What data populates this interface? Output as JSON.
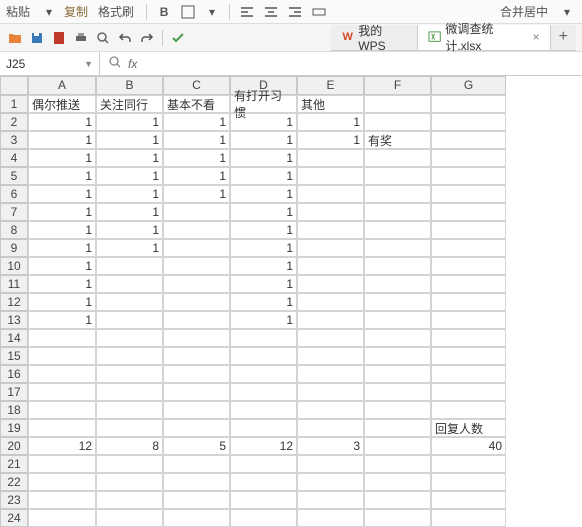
{
  "toolbar": {
    "paste_label": "粘贴",
    "copy_label": "复制",
    "format_painter_label": "格式刷",
    "merge_center_label": "合并居中"
  },
  "tabs": [
    {
      "label": "我的WPS",
      "icon": "wps-logo",
      "active": false
    },
    {
      "label": "微调查统计.xlsx",
      "icon": "excel-icon",
      "active": true
    }
  ],
  "namebox": {
    "value": "J25"
  },
  "formula": {
    "value": ""
  },
  "grid": {
    "columns": [
      "A",
      "B",
      "C",
      "D",
      "E",
      "F",
      "G"
    ],
    "row_count": 24,
    "headers_row": 1,
    "headers": [
      "偶尔推送",
      "关注同行",
      "基本不看",
      "有打开习惯",
      "其他",
      "",
      ""
    ],
    "data": {
      "2": {
        "A": "1",
        "B": "1",
        "C": "1",
        "D": "1",
        "E": "1"
      },
      "3": {
        "A": "1",
        "B": "1",
        "C": "1",
        "D": "1",
        "E": "1",
        "F": "有奖"
      },
      "4": {
        "A": "1",
        "B": "1",
        "C": "1",
        "D": "1"
      },
      "5": {
        "A": "1",
        "B": "1",
        "C": "1",
        "D": "1"
      },
      "6": {
        "A": "1",
        "B": "1",
        "C": "1",
        "D": "1"
      },
      "7": {
        "A": "1",
        "B": "1",
        "D": "1"
      },
      "8": {
        "A": "1",
        "B": "1",
        "D": "1"
      },
      "9": {
        "A": "1",
        "B": "1",
        "D": "1"
      },
      "10": {
        "A": "1",
        "D": "1"
      },
      "11": {
        "A": "1",
        "D": "1"
      },
      "12": {
        "A": "1",
        "D": "1"
      },
      "13": {
        "A": "1",
        "D": "1"
      },
      "19": {
        "G": "回复人数"
      },
      "20": {
        "A": "12",
        "B": "8",
        "C": "5",
        "D": "12",
        "E": "3",
        "G": "40"
      }
    },
    "text_cols": [
      "F"
    ],
    "text_cells": [
      "G19"
    ]
  }
}
